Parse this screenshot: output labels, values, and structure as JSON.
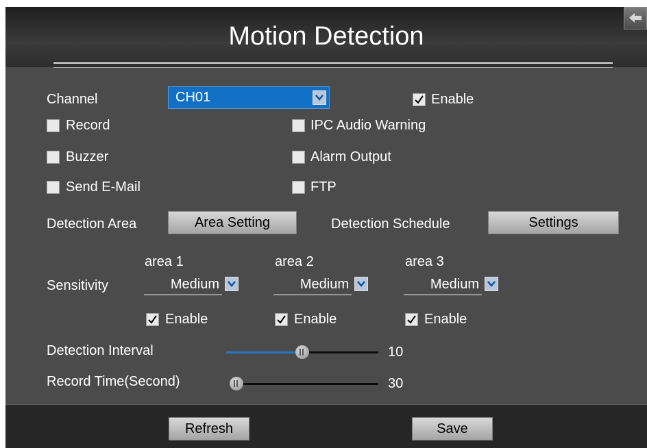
{
  "header": {
    "title": "Motion Detection"
  },
  "channel": {
    "label": "Channel",
    "value": "CH01",
    "enable_label": "Enable",
    "enable_checked": true
  },
  "checkboxes": {
    "record": {
      "label": "Record",
      "checked": false
    },
    "ipc_audio": {
      "label": "IPC Audio Warning",
      "checked": false
    },
    "buzzer": {
      "label": "Buzzer",
      "checked": false
    },
    "alarm_output": {
      "label": "Alarm Output",
      "checked": false
    },
    "send_email": {
      "label": "Send E-Mail",
      "checked": false
    },
    "ftp": {
      "label": "FTP",
      "checked": false
    }
  },
  "detection_area": {
    "label": "Detection Area",
    "button": "Area Setting"
  },
  "detection_schedule": {
    "label": "Detection Schedule",
    "button": "Settings"
  },
  "sensitivity": {
    "label": "Sensitivity",
    "areas": [
      {
        "name": "area 1",
        "value": "Medium",
        "enable_label": "Enable",
        "enabled": true
      },
      {
        "name": "area 2",
        "value": "Medium",
        "enable_label": "Enable",
        "enabled": true
      },
      {
        "name": "area 3",
        "value": "Medium",
        "enable_label": "Enable",
        "enabled": true
      }
    ]
  },
  "detection_interval": {
    "label": "Detection Interval",
    "value": "10",
    "fraction": 0.5
  },
  "record_time": {
    "label": "Record Time(Second)",
    "value": "30",
    "fraction": 0.0
  },
  "footer": {
    "refresh": "Refresh",
    "save": "Save"
  },
  "colors": {
    "accent": "#1270c4",
    "background": "#4b4b4b",
    "footer": "#262626"
  }
}
